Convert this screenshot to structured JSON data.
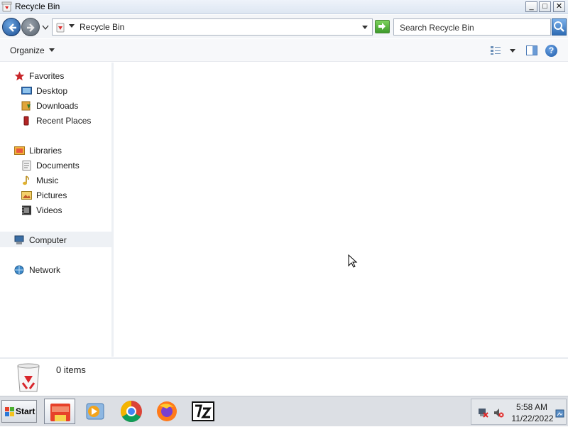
{
  "window": {
    "title": "Recycle Bin"
  },
  "nav": {
    "address_path": "Recycle Bin",
    "search_placeholder": "Search Recycle Bin"
  },
  "commandbar": {
    "organize_label": "Organize",
    "help_label": "?"
  },
  "sidebar": {
    "favorites": {
      "label": "Favorites",
      "icon": "star-icon"
    },
    "favorites_items": [
      {
        "label": "Desktop",
        "icon": "desktop-icon"
      },
      {
        "label": "Downloads",
        "icon": "downloads-icon"
      },
      {
        "label": "Recent Places",
        "icon": "recent-places-icon"
      }
    ],
    "libraries": {
      "label": "Libraries",
      "icon": "libraries-icon"
    },
    "libraries_items": [
      {
        "label": "Documents",
        "icon": "documents-icon"
      },
      {
        "label": "Music",
        "icon": "music-icon"
      },
      {
        "label": "Pictures",
        "icon": "pictures-icon"
      },
      {
        "label": "Videos",
        "icon": "videos-icon"
      }
    ],
    "computer": {
      "label": "Computer",
      "icon": "computer-icon"
    },
    "network": {
      "label": "Network",
      "icon": "network-icon"
    }
  },
  "details": {
    "item_count": "0 items"
  },
  "taskbar": {
    "start_label": "Start",
    "apps": [
      {
        "name": "file-explorer",
        "active": true
      },
      {
        "name": "media-player",
        "active": false
      },
      {
        "name": "chrome",
        "active": false
      },
      {
        "name": "firefox",
        "active": false
      },
      {
        "name": "7-zip",
        "active": false
      }
    ],
    "clock_time": "5:58 AM",
    "clock_date": "11/22/2022"
  }
}
